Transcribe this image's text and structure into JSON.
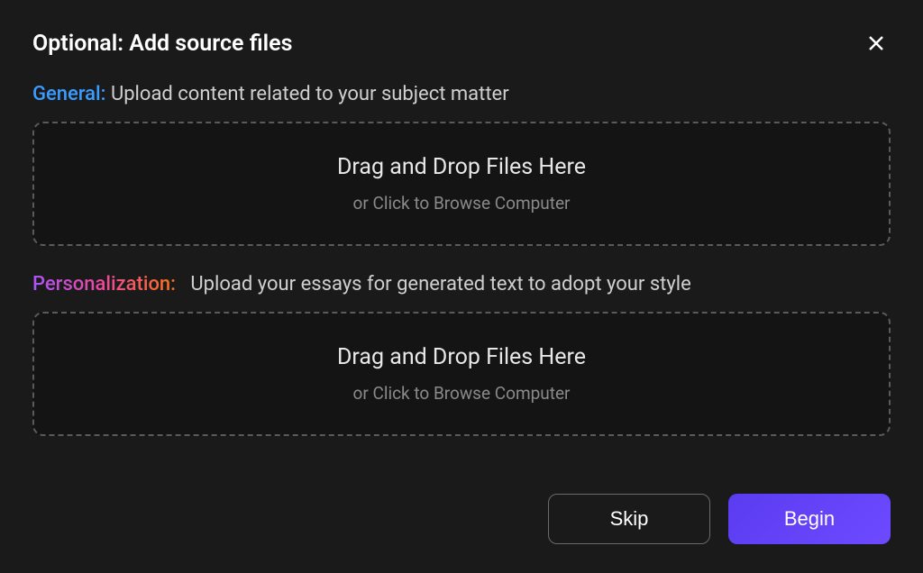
{
  "dialog": {
    "title": "Optional: Add source files"
  },
  "sections": {
    "general": {
      "label": "General:",
      "description": "Upload content related to your subject matter",
      "dropzone": {
        "main": "Drag and Drop Files Here",
        "sub": "or Click to Browse Computer"
      }
    },
    "personalization": {
      "label": "Personalization:",
      "description": "Upload your essays for generated text to adopt your style",
      "dropzone": {
        "main": "Drag and Drop Files Here",
        "sub": "or Click to Browse Computer"
      }
    }
  },
  "footer": {
    "skip_label": "Skip",
    "begin_label": "Begin"
  }
}
